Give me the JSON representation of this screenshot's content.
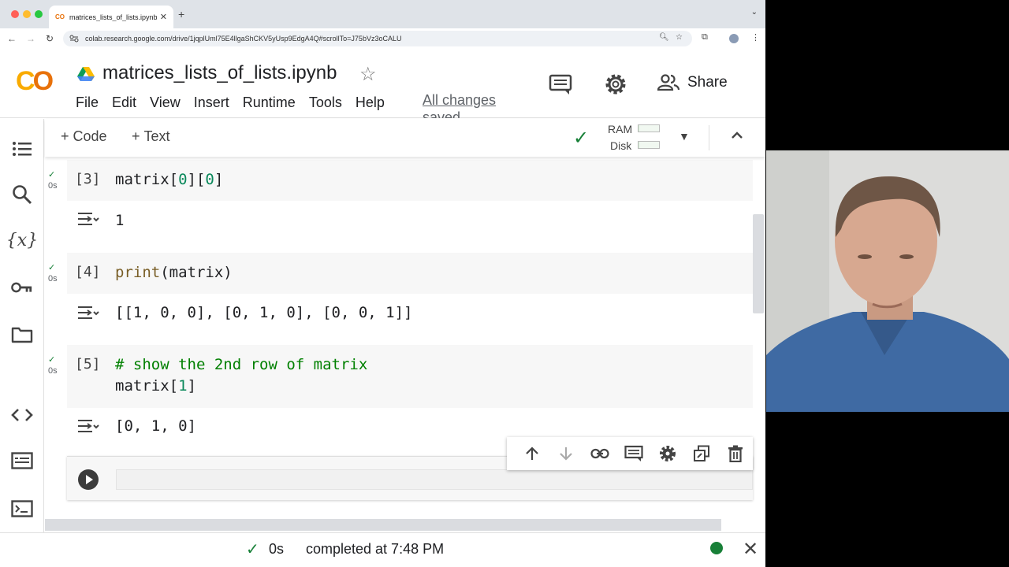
{
  "browser": {
    "tab_title": "matrices_lists_of_lists.ipynb",
    "tab_favicon": "CO",
    "url": "colab.research.google.com/drive/1jqplUml75E4llgaShCKV5yUsp9EdgA4Q#scrollTo=J75bVz3oCALU"
  },
  "colab": {
    "logo_text": "CO",
    "notebook_name": "matrices_lists_of_lists.ipynb",
    "menu": [
      "File",
      "Edit",
      "View",
      "Insert",
      "Runtime",
      "Tools",
      "Help"
    ],
    "save_status": "All changes saved",
    "share_label": "Share"
  },
  "toolbar": {
    "add_code": "Code",
    "add_text": "Text",
    "ram_label": "RAM",
    "disk_label": "Disk",
    "ram_usage": 0.05,
    "disk_usage": 0.05
  },
  "cells": [
    {
      "prompt": "[3]",
      "time": "0s",
      "code_html": "matrix[<span class=\"num\">0</span>][<span class=\"num\">0</span>]",
      "output": "1"
    },
    {
      "prompt": "[4]",
      "time": "0s",
      "code_html": "<span class=\"kw\">print</span>(matrix)",
      "output": "[[1, 0, 0], [0, 1, 0], [0, 0, 1]]"
    },
    {
      "prompt": "[5]",
      "time": "0s",
      "code_html": "<span class=\"cm\"># show the 2nd row of matrix</span>\nmatrix[<span class=\"num\">1</span>]",
      "output": "[0, 1, 0]"
    }
  ],
  "statusbar": {
    "duration": "0s",
    "message": "completed at 7:48 PM"
  },
  "colors": {
    "success": "#188038",
    "colab_orange": "#e8710a",
    "colab_yellow": "#f9ab00"
  }
}
